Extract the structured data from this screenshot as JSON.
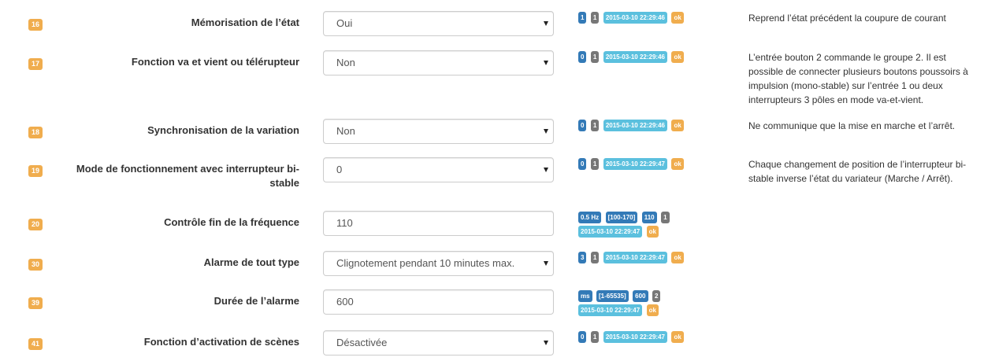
{
  "params": [
    {
      "num": "16",
      "label": "Mémorisation de l’état",
      "type": "select",
      "value": "Oui",
      "badges": [
        {
          "text": "1",
          "color": "blue"
        },
        {
          "text": "1",
          "color": "gray"
        },
        {
          "text": "2015-03-10 22:29:46",
          "color": "info"
        },
        {
          "text": "ok",
          "color": "ok"
        }
      ],
      "description": "Reprend l’état précédent la coupure de courant"
    },
    {
      "num": "17",
      "label": "Fonction va et vient ou télérupteur",
      "type": "select",
      "value": "Non",
      "badges": [
        {
          "text": "0",
          "color": "blue"
        },
        {
          "text": "1",
          "color": "gray"
        },
        {
          "text": "2015-03-10 22:29:46",
          "color": "info"
        },
        {
          "text": "ok",
          "color": "ok"
        }
      ],
      "description": "L’entrée bouton 2 commande le groupe 2. Il est possible de connecter plusieurs boutons poussoirs à impulsion (mono-stable) sur l’entrée 1 ou deux interrupteurs 3 pôles en mode va-et-vient."
    },
    {
      "num": "18",
      "label": "Synchronisation de la variation",
      "type": "select",
      "value": "Non",
      "badges": [
        {
          "text": "0",
          "color": "blue"
        },
        {
          "text": "1",
          "color": "gray"
        },
        {
          "text": "2015-03-10 22:29:46",
          "color": "info"
        },
        {
          "text": "ok",
          "color": "ok"
        }
      ],
      "description": "Ne communique que la mise en marche et l’arrêt."
    },
    {
      "num": "19",
      "label": "Mode de fonctionnement avec interrupteur bi-stable",
      "type": "select",
      "value": "0",
      "badges": [
        {
          "text": "0",
          "color": "blue"
        },
        {
          "text": "1",
          "color": "gray"
        },
        {
          "text": "2015-03-10 22:29:47",
          "color": "info"
        },
        {
          "text": "ok",
          "color": "ok"
        }
      ],
      "description": "Chaque changement de position de l’interrupteur bi-stable inverse l’état du variateur (Marche / Arrêt)."
    },
    {
      "num": "20",
      "label": "Contrôle fin de la fréquence",
      "type": "input",
      "value": "110",
      "badges": [
        {
          "text": "0.5 Hz",
          "color": "blue"
        },
        {
          "text": "[100-170]",
          "color": "blue"
        },
        {
          "text": "110",
          "color": "blue"
        },
        {
          "text": "1",
          "color": "gray"
        },
        {
          "text": "2015-03-10 22:29:47",
          "color": "info"
        },
        {
          "text": "ok",
          "color": "ok"
        }
      ],
      "description": ""
    },
    {
      "num": "30",
      "label": "Alarme de tout type",
      "type": "select",
      "value": "Clignotement pendant 10 minutes max.",
      "badges": [
        {
          "text": "3",
          "color": "blue"
        },
        {
          "text": "1",
          "color": "gray"
        },
        {
          "text": "2015-03-10 22:29:47",
          "color": "info"
        },
        {
          "text": "ok",
          "color": "ok"
        }
      ],
      "description": ""
    },
    {
      "num": "39",
      "label": "Durée de l’alarme",
      "type": "input",
      "value": "600",
      "badges": [
        {
          "text": "ms",
          "color": "blue"
        },
        {
          "text": "[1-65535]",
          "color": "blue"
        },
        {
          "text": "600",
          "color": "blue"
        },
        {
          "text": "2",
          "color": "gray"
        },
        {
          "text": "2015-03-10 22:29:47",
          "color": "info"
        },
        {
          "text": "ok",
          "color": "ok"
        }
      ],
      "description": ""
    },
    {
      "num": "41",
      "label": "Fonction d’activation de scènes",
      "type": "select",
      "value": "Désactivée",
      "badges": [
        {
          "text": "0",
          "color": "blue"
        },
        {
          "text": "1",
          "color": "gray"
        },
        {
          "text": "2015-03-10 22:29:47",
          "color": "info"
        },
        {
          "text": "ok",
          "color": "ok"
        }
      ],
      "description": ""
    }
  ]
}
